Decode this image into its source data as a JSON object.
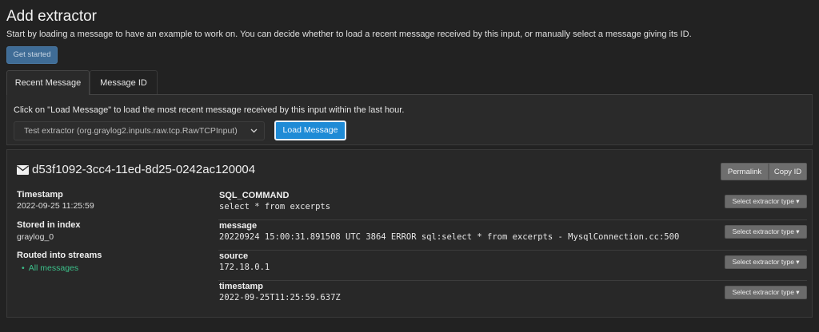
{
  "page": {
    "title": "Add extractor",
    "description": "Start by loading a message to have an example to work on. You can decide whether to load a recent message received by this input, or manually select a message giving its ID.",
    "get_started_label": "Get started"
  },
  "tabs": [
    {
      "label": "Recent Message",
      "active": true
    },
    {
      "label": "Message ID",
      "active": false
    }
  ],
  "recent_panel": {
    "help_text": "Click on \"Load Message\" to load the most recent message received by this input within the last hour.",
    "input_select": {
      "selected": "Test extractor (org.graylog2.inputs.raw.tcp.RawTCPInput)",
      "icon": "chevron-down-icon"
    },
    "load_button_label": "Load Message"
  },
  "message": {
    "id": "d53f1092-3cc4-11ed-8d25-0242ac120004",
    "icon": "envelope-icon",
    "actions": {
      "permalink": "Permalink",
      "copy_id": "Copy ID"
    },
    "meta": {
      "timestamp_label": "Timestamp",
      "timestamp_value": "2022-09-25 11:25:59",
      "index_label": "Stored in index",
      "index_value": "graylog_0",
      "streams_label": "Routed into streams",
      "streams": [
        "All messages"
      ]
    },
    "fields": [
      {
        "name": "SQL_COMMAND",
        "value": "select * from excerpts",
        "action": "Select extractor type ▾"
      },
      {
        "name": "message",
        "value": "20220924 15:00:31.891508 UTC 3864 ERROR sql:select * from excerpts - MysqlConnection.cc:500",
        "action": "Select extractor type ▾"
      },
      {
        "name": "source",
        "value": "172.18.0.1",
        "action": "Select extractor type ▾"
      },
      {
        "name": "timestamp",
        "value": "2022-09-25T11:25:59.637Z",
        "action": "Select extractor type ▾"
      }
    ]
  },
  "colors": {
    "background": "#222222",
    "primary": "#1e8bd6",
    "link": "#3cc08a",
    "button_gray": "#6b6b6b"
  }
}
